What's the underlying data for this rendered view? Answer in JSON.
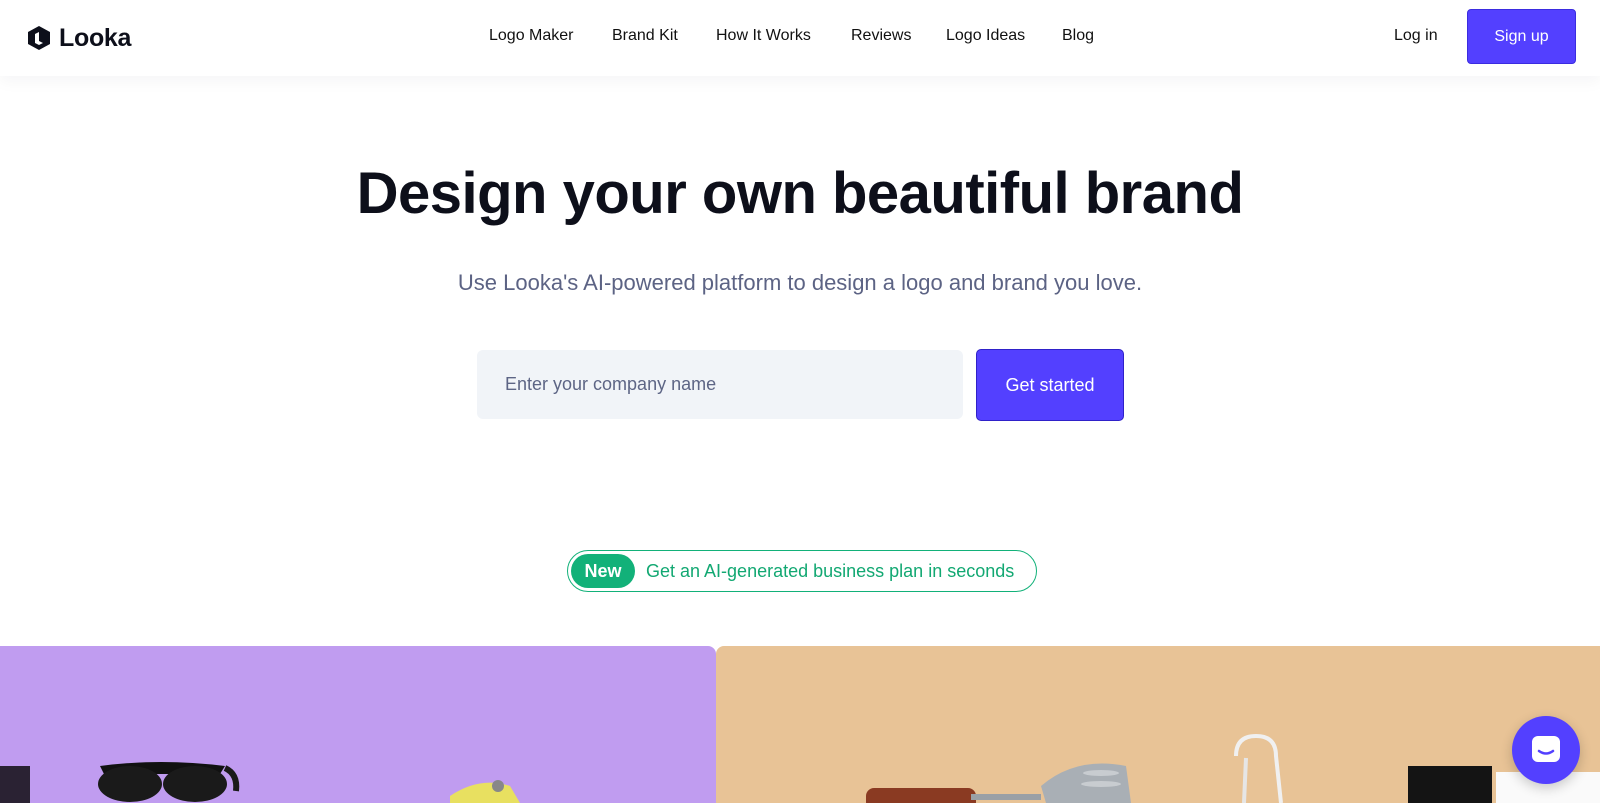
{
  "header": {
    "brand": "Looka",
    "nav": [
      {
        "label": "Logo Maker"
      },
      {
        "label": "Brand Kit"
      },
      {
        "label": "How It Works"
      },
      {
        "label": "Reviews"
      },
      {
        "label": "Logo Ideas"
      },
      {
        "label": "Blog"
      }
    ],
    "login_label": "Log in",
    "signup_label": "Sign up"
  },
  "hero": {
    "title": "Design your own beautiful brand",
    "subtitle": "Use Looka's AI-powered platform to design a logo and brand you love.",
    "input_placeholder": "Enter your company name",
    "input_value": "",
    "cta_label": "Get started"
  },
  "promo": {
    "badge": "New",
    "text": "Get an AI-generated business plan in seconds"
  },
  "colors": {
    "accent": "#5340ff",
    "promo_green": "#12b179",
    "panel_left": "#c09cf0",
    "panel_right": "#e8c396"
  },
  "icons": {
    "logo": "looka-hexagon-icon",
    "chat": "chat-bubble-icon"
  }
}
